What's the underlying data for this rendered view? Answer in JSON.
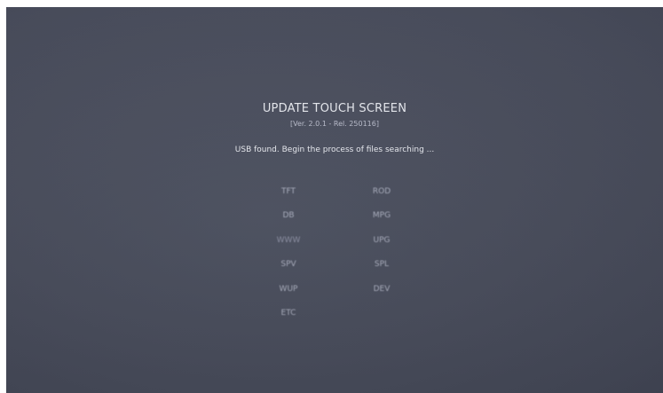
{
  "screen": {
    "title": "UPDATE TOUCH SCREEN",
    "version": "[Ver. 2.0.1 - Rel. 250116]",
    "status": "USB found. Begin the process of files searching ..."
  },
  "file_types": {
    "left": [
      "TFT",
      "DB",
      "WWW",
      "SPV",
      "WUP",
      "ETC"
    ],
    "right": [
      "ROD",
      "MPG",
      "UPG",
      "SPL",
      "DEV"
    ]
  }
}
